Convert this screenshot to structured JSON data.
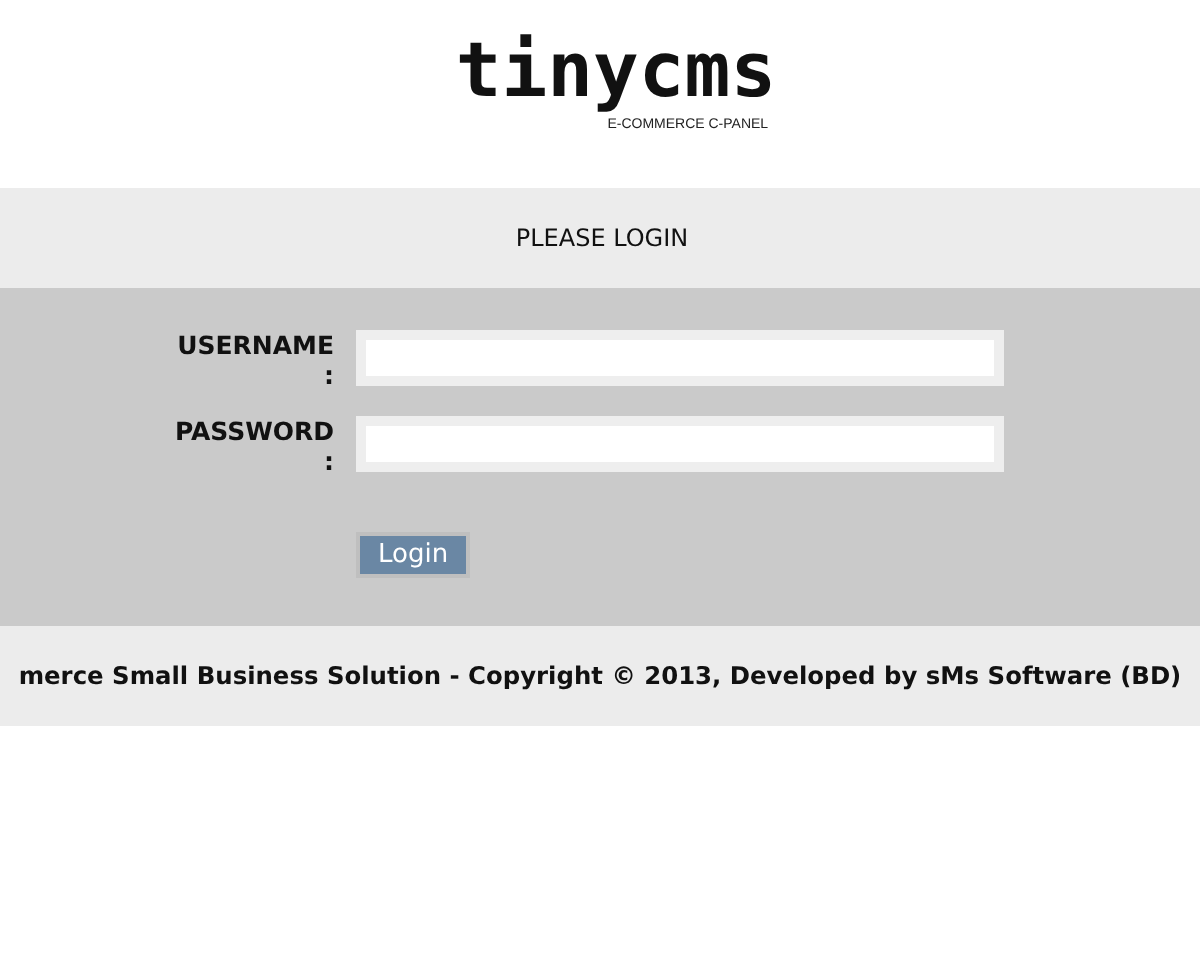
{
  "logo": {
    "name": "tinycms",
    "tagline": "E-COMMERCE C-PANEL"
  },
  "header": {
    "title": "PLEASE LOGIN"
  },
  "form": {
    "fields": [
      {
        "label": "USERNAME :"
      },
      {
        "label": "PASSWORD :"
      }
    ],
    "button": "Login"
  },
  "footer": {
    "text": "merce Small Business Solution - Copyright © 2013, Developed by sMs Software (BD)"
  }
}
